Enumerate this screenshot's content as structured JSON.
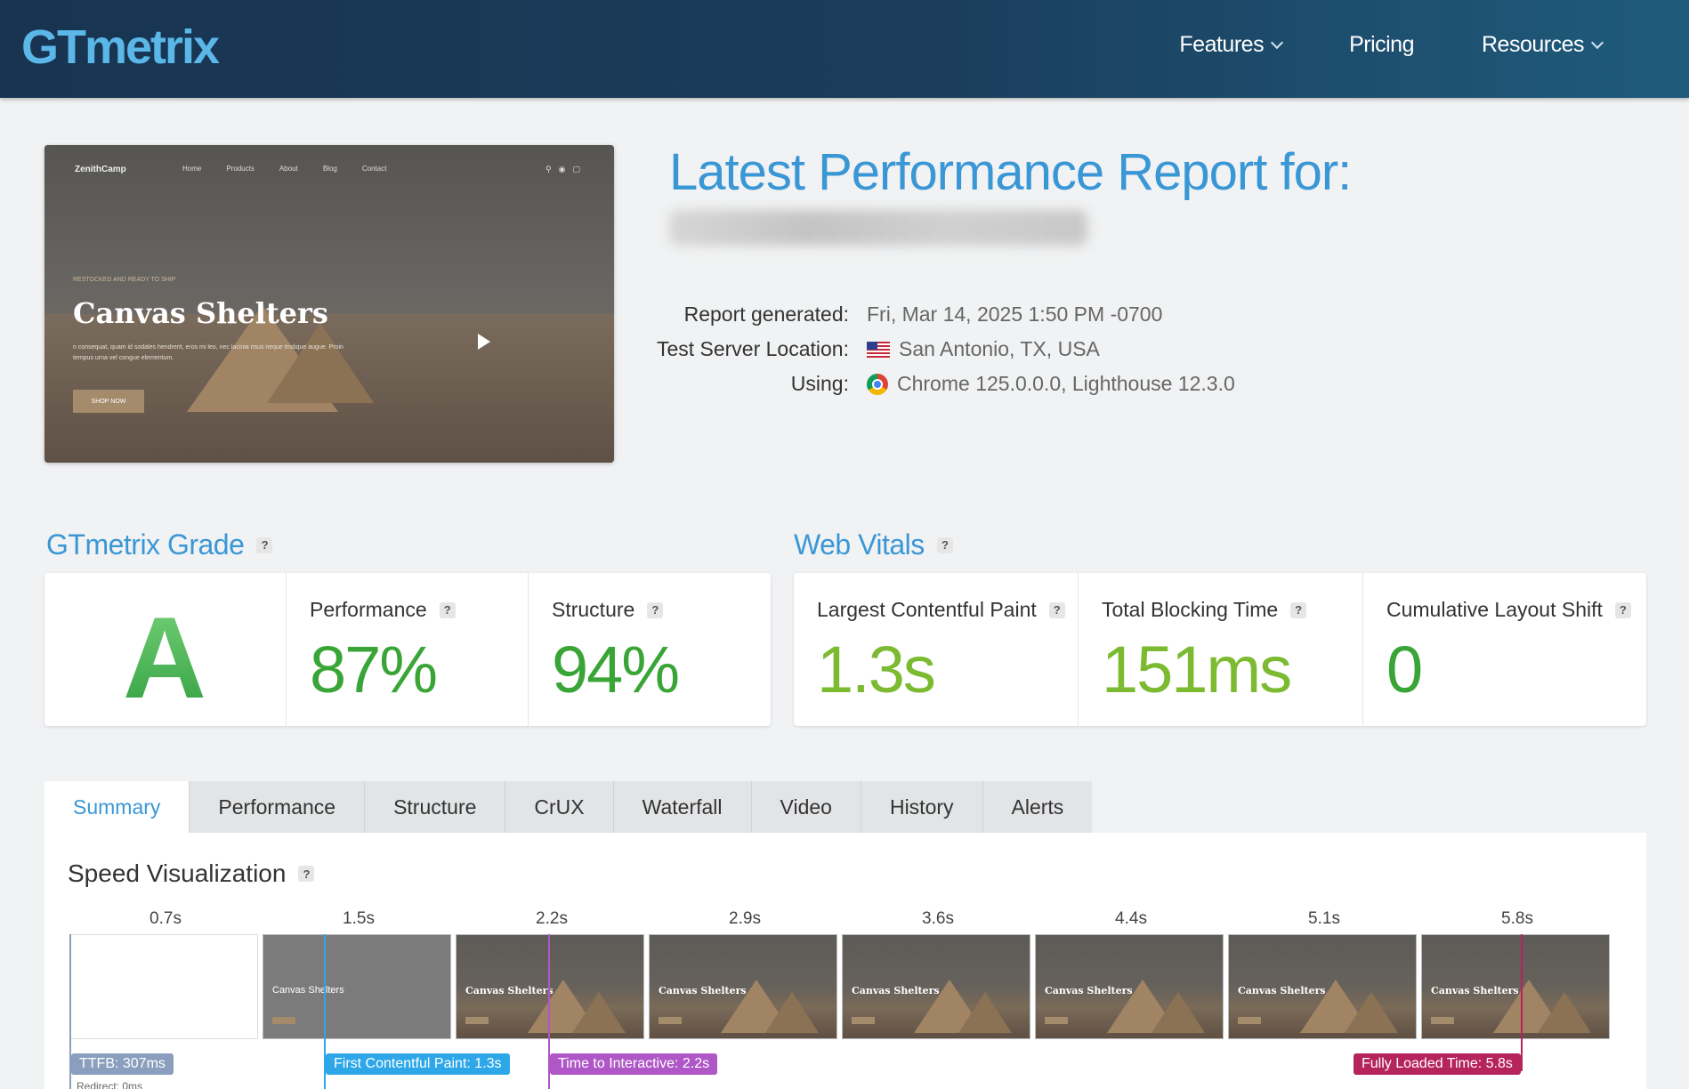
{
  "header": {
    "logo": "GTmetrix",
    "nav": [
      {
        "label": "Features",
        "has_dropdown": true
      },
      {
        "label": "Pricing",
        "has_dropdown": false
      },
      {
        "label": "Resources",
        "has_dropdown": true
      }
    ]
  },
  "screenshot": {
    "brand": "ZenithCamp",
    "nav": [
      "Home",
      "Products",
      "About",
      "Blog",
      "Contact"
    ],
    "eyebrow": "RESTOCKED AND READY TO SHIP",
    "title": "Canvas Shelters",
    "description": "n consequat, quam id sodales hendrerit, eros mi leo, nec lacinia risus neque tristique augue. Proin tempus urna vel congue elementum.",
    "button": "SHOP NOW"
  },
  "report": {
    "title": "Latest Performance Report for:",
    "rows": [
      {
        "label": "Report generated:",
        "value": "Fri, Mar 14, 2025 1:50 PM -0700"
      },
      {
        "label": "Test Server Location:",
        "value": "San Antonio, TX, USA"
      },
      {
        "label": "Using:",
        "value": "Chrome 125.0.0.0, Lighthouse 12.3.0"
      }
    ]
  },
  "grade": {
    "title": "GTmetrix Grade",
    "letter": "A",
    "performance_label": "Performance",
    "performance_value": "87%",
    "structure_label": "Structure",
    "structure_value": "94%"
  },
  "vitals": {
    "title": "Web Vitals",
    "lcp_label": "Largest Contentful Paint",
    "lcp_value": "1.3s",
    "tbt_label": "Total Blocking Time",
    "tbt_value": "151ms",
    "cls_label": "Cumulative Layout Shift",
    "cls_value": "0"
  },
  "tabs": [
    "Summary",
    "Performance",
    "Structure",
    "CrUX",
    "Waterfall",
    "Video",
    "History",
    "Alerts"
  ],
  "speed": {
    "title": "Speed Visualization",
    "ticks": [
      "0.7s",
      "1.5s",
      "2.2s",
      "2.9s",
      "3.6s",
      "4.4s",
      "5.1s",
      "5.8s"
    ],
    "frame_title": "Canvas Shelters",
    "markers": {
      "ttfb": "TTFB: 307ms",
      "redirect": "Redirect: 0ms",
      "fcp": "First Contentful Paint: 1.3s",
      "tti": "Time to Interactive: 2.2s",
      "flt": "Fully Loaded Time: 5.8s"
    }
  },
  "colors": {
    "accent": "#3a97d6",
    "grade_green": "#3aa537",
    "vital_green": "#7cbb31",
    "ttfb": "#8a9fbe",
    "fcp": "#2ea7e8",
    "tti": "#b057c7",
    "flt": "#b5245c"
  },
  "icons": {
    "flag": "us-flag-icon",
    "browser": "chrome-icon",
    "help": "question-icon",
    "dropdown": "chevron-down-icon",
    "video_play": "play-icon"
  }
}
